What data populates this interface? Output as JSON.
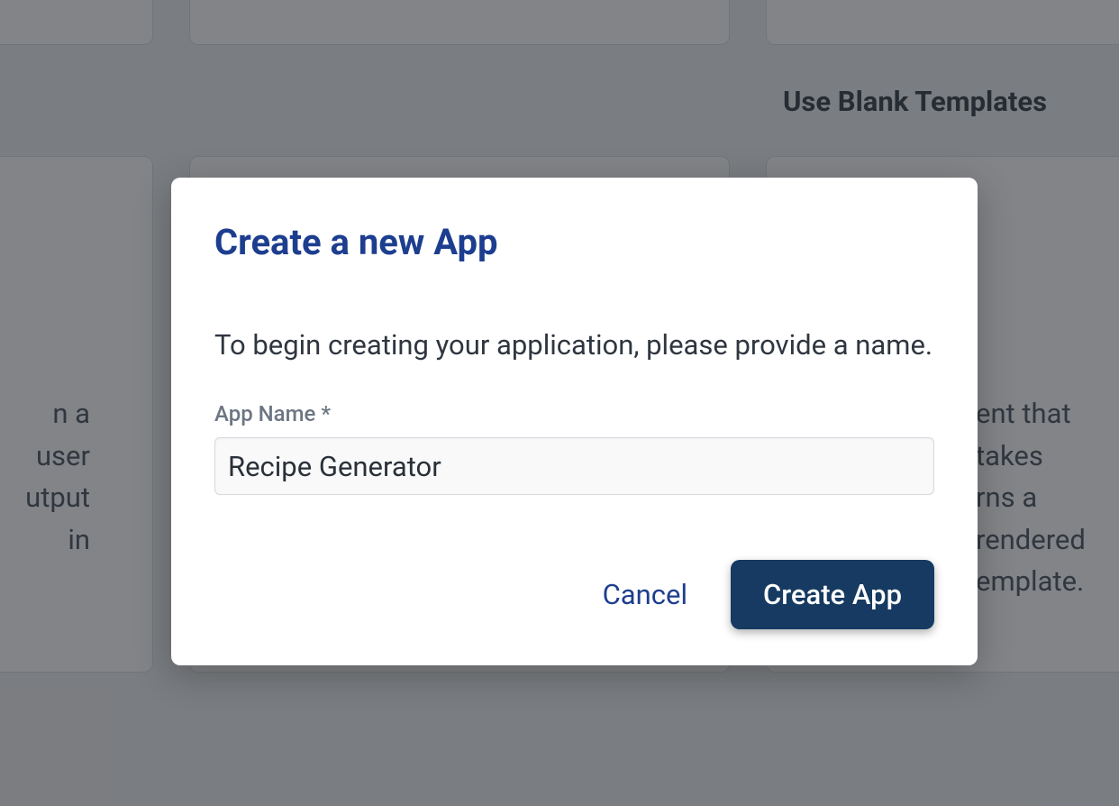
{
  "background": {
    "section_heading": "Use Blank Templates",
    "left_card_text_line1": "n a user",
    "left_card_text_line2": "utput in",
    "right_card_text_line1": "ent that takes",
    "right_card_text_line2": "rns a rendered",
    "right_card_text_line3": "emplate."
  },
  "modal": {
    "title": "Create a new App",
    "description": "To begin creating your application, please provide a name.",
    "app_name_label": "App Name *",
    "app_name_value": "Recipe Generator",
    "cancel_label": "Cancel",
    "create_label": "Create App"
  }
}
